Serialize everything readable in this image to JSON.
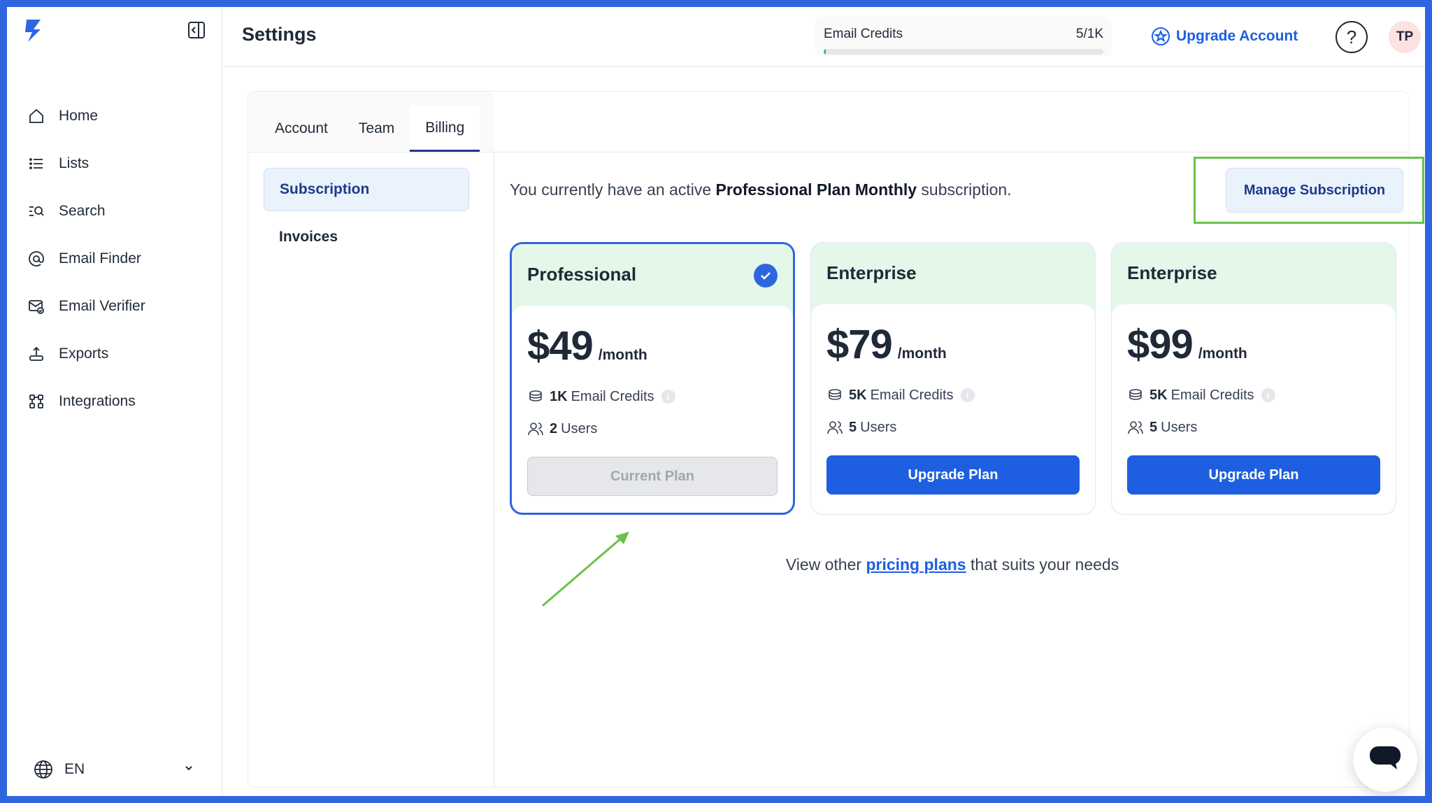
{
  "sidebar": {
    "items": [
      {
        "label": "Home",
        "icon": "home-icon"
      },
      {
        "label": "Lists",
        "icon": "list-icon"
      },
      {
        "label": "Search",
        "icon": "search-icon"
      },
      {
        "label": "Email Finder",
        "icon": "at-sign-icon"
      },
      {
        "label": "Email Verifier",
        "icon": "mail-check-icon"
      },
      {
        "label": "Exports",
        "icon": "export-icon"
      },
      {
        "label": "Integrations",
        "icon": "integrations-icon"
      }
    ],
    "language": "EN"
  },
  "header": {
    "title": "Settings",
    "credits_label": "Email Credits",
    "credits_value": "5/1K",
    "credits_fraction": 0.005,
    "upgrade_label": "Upgrade Account",
    "help_label": "?",
    "avatar_initials": "TP"
  },
  "tabs": [
    "Account",
    "Team",
    "Billing"
  ],
  "active_tab": "Billing",
  "subnav": [
    "Subscription",
    "Invoices"
  ],
  "subscription": {
    "text_prefix": "You currently have an active ",
    "plan_name": "Professional Plan Monthly",
    "text_suffix": " subscription.",
    "manage_label": "Manage Subscription"
  },
  "plans": [
    {
      "name": "Professional",
      "price": "$49",
      "period": "/month",
      "credits_amount": "1K",
      "credits_label": "Email Credits",
      "users_amount": "2",
      "users_label": "Users",
      "button": "Current Plan",
      "current": true
    },
    {
      "name": "Enterprise",
      "price": "$79",
      "period": "/month",
      "credits_amount": "5K",
      "credits_label": "Email Credits",
      "users_amount": "5",
      "users_label": "Users",
      "button": "Upgrade Plan",
      "current": false
    },
    {
      "name": "Enterprise",
      "price": "$99",
      "period": "/month",
      "credits_amount": "5K",
      "credits_label": "Email Credits",
      "users_amount": "5",
      "users_label": "Users",
      "button": "Upgrade Plan",
      "current": false
    }
  ],
  "other_plans": {
    "prefix": "View other ",
    "link": "pricing plans",
    "suffix": " that suits your needs"
  },
  "colors": {
    "accent": "#1d5fe0",
    "highlight_box": "#6ac24a",
    "plan_header_bg": "#e3f8e8",
    "frame_border": "#2f66e0"
  }
}
